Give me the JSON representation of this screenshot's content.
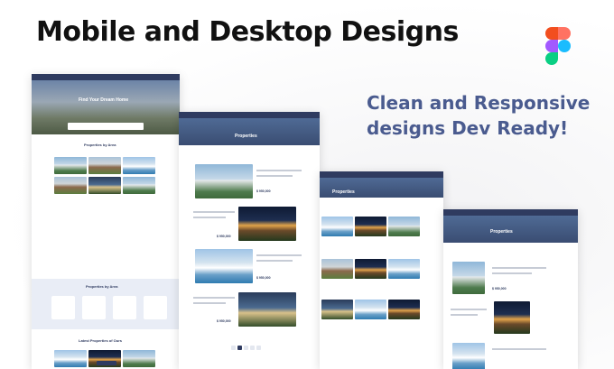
{
  "banner": {
    "headline": "Mobile and Desktop Designs",
    "tagline": "Clean and Responsive designs Dev Ready!",
    "logo": "figma-logo"
  },
  "mockups": {
    "home": {
      "hero_title": "Find Your Dream Home",
      "section1": "Properties by Area",
      "section2": "Properties by Area",
      "section3": "Latest Properties of Ours"
    },
    "list_desktop": {
      "header_title": "Properties",
      "price": "$ 950,000"
    },
    "grid_tablet": {
      "header_title": "Properties"
    },
    "list_tablet": {
      "header_title": "Properties",
      "price": "$ 950,000"
    }
  },
  "colors": {
    "tagline": "#4a5b8f",
    "nav": "#2f3b60"
  }
}
